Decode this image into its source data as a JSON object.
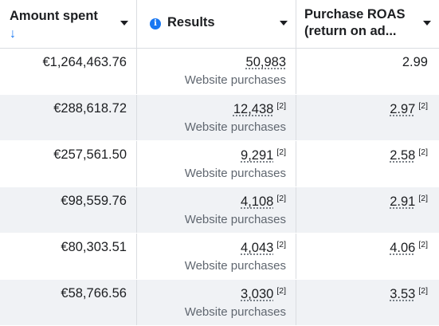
{
  "header": {
    "amount_spent": "Amount spent",
    "sort_arrow": "↓",
    "info_icon_glyph": "i",
    "results": "Results",
    "roas_line1": "Purchase ROAS",
    "roas_line2": "(return on ad..."
  },
  "rows": [
    {
      "amount": "€1,264,463.76",
      "results": "50,983",
      "results_note": "",
      "results_sub": "Website purchases",
      "roas": "2.99",
      "roas_note": ""
    },
    {
      "amount": "€288,618.72",
      "results": "12,438",
      "results_note": "[2]",
      "results_sub": "Website purchases",
      "roas": "2.97",
      "roas_note": "[2]"
    },
    {
      "amount": "€257,561.50",
      "results": "9,291",
      "results_note": "[2]",
      "results_sub": "Website purchases",
      "roas": "2.58",
      "roas_note": "[2]"
    },
    {
      "amount": "€98,559.76",
      "results": "4,108",
      "results_note": "[2]",
      "results_sub": "Website purchases",
      "roas": "2.91",
      "roas_note": "[2]"
    },
    {
      "amount": "€80,303.51",
      "results": "4,043",
      "results_note": "[2]",
      "results_sub": "Website purchases",
      "roas": "4.06",
      "roas_note": "[2]"
    },
    {
      "amount": "€58,766.56",
      "results": "3,030",
      "results_note": "[2]",
      "results_sub": "Website purchases",
      "roas": "3.53",
      "roas_note": "[2]"
    }
  ],
  "colors": {
    "accent": "#1877f2",
    "alt_row": "#f0f2f5",
    "muted_text": "#606770"
  }
}
